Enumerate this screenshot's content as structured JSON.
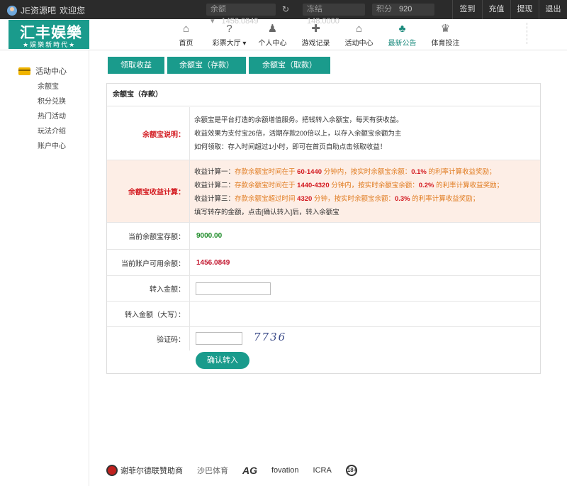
{
  "topbar": {
    "username": "JE资源吧",
    "welcome": "欢迎您",
    "balance_label": "余额 ▾",
    "balance_value": "1456.0849",
    "frozen_label": "冻结",
    "frozen_value": "148.0000",
    "points_label": "积分",
    "points_value": "920",
    "links": [
      "签到",
      "充值",
      "提现",
      "退出"
    ]
  },
  "logo": {
    "title": "汇丰娱樂",
    "subtitle": "★娱樂新時代★"
  },
  "nav": [
    {
      "label": "首页",
      "icon": "home-icon",
      "glyph": "⌂"
    },
    {
      "label": "彩票大厅 ▾",
      "icon": "lottery-icon",
      "glyph": "?"
    },
    {
      "label": "个人中心",
      "icon": "user-icon",
      "glyph": "♟"
    },
    {
      "label": "游戏记录",
      "icon": "gamepad-icon",
      "glyph": "✚"
    },
    {
      "label": "活动中心",
      "icon": "gift-icon",
      "glyph": "⌂"
    },
    {
      "label": "最新公告",
      "icon": "cards-icon",
      "glyph": "♣"
    },
    {
      "label": "体育投注",
      "icon": "trophy-icon",
      "glyph": "♛"
    }
  ],
  "sidebar": {
    "title": "活动中心",
    "items": [
      "余额宝",
      "积分兑换",
      "热门活动",
      "玩法介绍",
      "账户中心"
    ]
  },
  "tabs": [
    "领取收益",
    "余额宝（存款）",
    "余额宝（取款）"
  ],
  "panel": {
    "title": "余额宝（存款）",
    "desc_label": "余额宝说明：",
    "desc_lines": [
      "余额宝是平台打造的余额增值服务。把钱转入余额宝，每天有获收益。",
      "收益效果为支付宝26倍，活期存款200倍以上，以存入余额宝余额为主",
      "如何领取：存入时间超过1小时，即可在首页自助点击领取收益！"
    ],
    "calc_label": "余额宝收益计算：",
    "calc": [
      {
        "prefix": "收益计算一：",
        "a": "存款余额宝时间在于",
        "range": "60-1440",
        "b": "分钟内，按实时余额宝余额：",
        "rate": "0.1%",
        "c": "的利率计算收益奖励；"
      },
      {
        "prefix": "收益计算二：",
        "a": "存款余额宝时间在于",
        "range": "1440-4320",
        "b": "分钟内，按实时余额宝余额：",
        "rate": "0.2%",
        "c": "的利率计算收益奖励；"
      },
      {
        "prefix": "收益计算三：",
        "a": "存款余额宝超过时间",
        "range": "4320",
        "b": "分钟，按实时余额宝余额：",
        "rate": "0.3%",
        "c": "的利率计算收益奖励；"
      }
    ],
    "calc_note": "填写转存的金额，点击[确认转入]后，转入余额宝",
    "current_label": "当前余额宝存额：",
    "current_value": "9000.00",
    "available_label": "当前账户可用余额：",
    "available_value": "1456.0849",
    "amount_label": "转入金额：",
    "amount_upper_label": "转入金额（大写）：",
    "captcha_label": "验证码：",
    "captcha_value": "7736",
    "submit_label": "确认转入"
  },
  "footer": {
    "sponsor": "谢菲尔德联赞助商",
    "logos": [
      "沙巴体育",
      "AG",
      "fovation",
      "ICRA",
      "18+"
    ]
  },
  "colors": {
    "accent": "#1a9b8c",
    "topbar": "#2b2b2b",
    "highlight": "#e07b1f",
    "alert": "#d3191f"
  }
}
